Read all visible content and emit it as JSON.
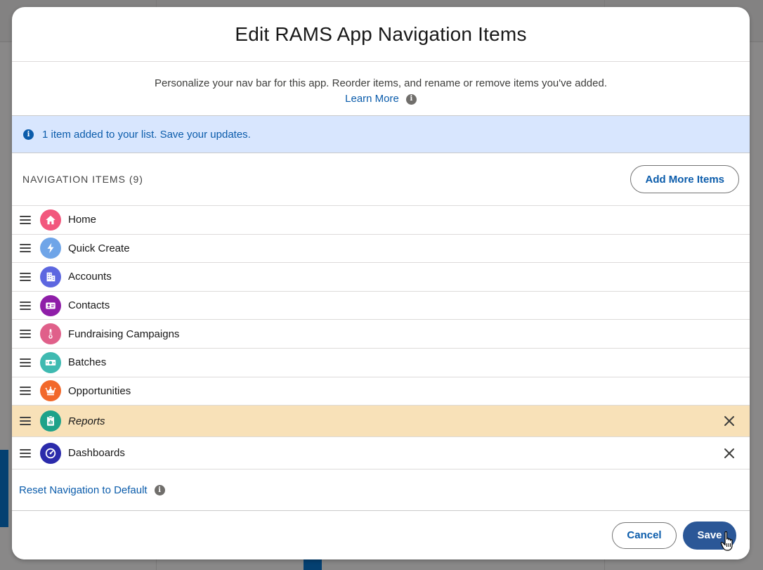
{
  "modal": {
    "title": "Edit RAMS App Navigation Items",
    "intro_text": "Personalize your nav bar for this app. Reorder items, and rename or remove items you've added.",
    "learn_more": "Learn More"
  },
  "alert": {
    "message": "1 item added to your list. Save your updates."
  },
  "list": {
    "heading": "NAVIGATION ITEMS (9)",
    "add_more_label": "Add More Items",
    "items": [
      {
        "label": "Home",
        "icon": "home-icon",
        "color": "#f2577d"
      },
      {
        "label": "Quick Create",
        "icon": "lightning-icon",
        "color": "#6fa5e8"
      },
      {
        "label": "Accounts",
        "icon": "building-icon",
        "color": "#5d67e0"
      },
      {
        "label": "Contacts",
        "icon": "contact-card-icon",
        "color": "#8f1ea8"
      },
      {
        "label": "Fundraising Campaigns",
        "icon": "thermometer-icon",
        "color": "#e0608a"
      },
      {
        "label": "Batches",
        "icon": "money-icon",
        "color": "#3fbab1"
      },
      {
        "label": "Opportunities",
        "icon": "crown-icon",
        "color": "#f2682a"
      },
      {
        "label": "Reports",
        "icon": "report-clipboard-icon",
        "color": "#1ea28a"
      },
      {
        "label": "Dashboards",
        "icon": "gauge-icon",
        "color": "#2b2bab"
      }
    ]
  },
  "reset": {
    "label": "Reset Navigation to Default"
  },
  "footer": {
    "cancel_label": "Cancel",
    "save_label": "Save"
  },
  "colors": {
    "link": "#0b5cab",
    "alert_bg": "#d8e6fe",
    "selected_row_bg": "#f8e1b8",
    "primary_button": "#2b5797"
  }
}
